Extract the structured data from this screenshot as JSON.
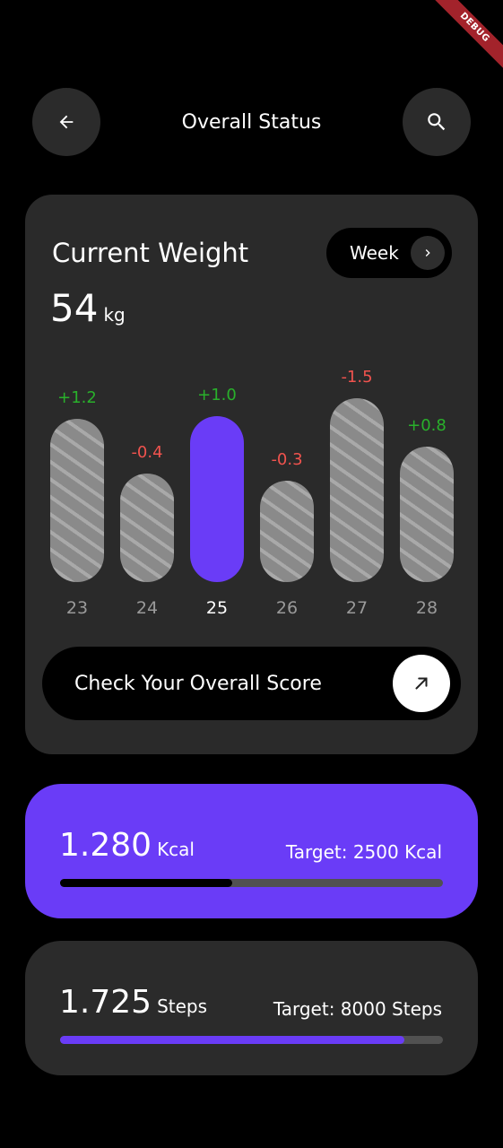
{
  "debug_label": "DEBUG",
  "header": {
    "title": "Overall Status",
    "back_icon": "arrow-left-icon",
    "search_icon": "search-icon"
  },
  "weight_card": {
    "title": "Current Weight",
    "value": "54",
    "unit": "kg",
    "period_label": "Week",
    "bars": [
      {
        "day": "23",
        "delta": "+1.2",
        "delta_value": 1.2,
        "active": false
      },
      {
        "day": "24",
        "delta": "-0.4",
        "delta_value": -0.4,
        "active": false
      },
      {
        "day": "25",
        "delta": "+1.0",
        "delta_value": 1.0,
        "active": true
      },
      {
        "day": "26",
        "delta": "-0.3",
        "delta_value": -0.3,
        "active": false
      },
      {
        "day": "27",
        "delta": "-1.5",
        "delta_value": -1.5,
        "active": false
      },
      {
        "day": "28",
        "delta": "+0.8",
        "delta_value": 0.8,
        "active": false
      }
    ],
    "score_button_label": "Check Your Overall Score"
  },
  "kcal_card": {
    "value": "1.280",
    "unit": "Kcal",
    "target": "Target: 2500 Kcal",
    "progress": 0.45
  },
  "steps_card": {
    "value": "1.725",
    "unit": "Steps",
    "target": "Target: 8000 Steps",
    "progress": 0.9
  },
  "colors": {
    "accent": "#6a3cf7",
    "positive": "#29b02b",
    "negative": "#f0534e",
    "card": "#2a2a2a",
    "background": "#000000"
  }
}
